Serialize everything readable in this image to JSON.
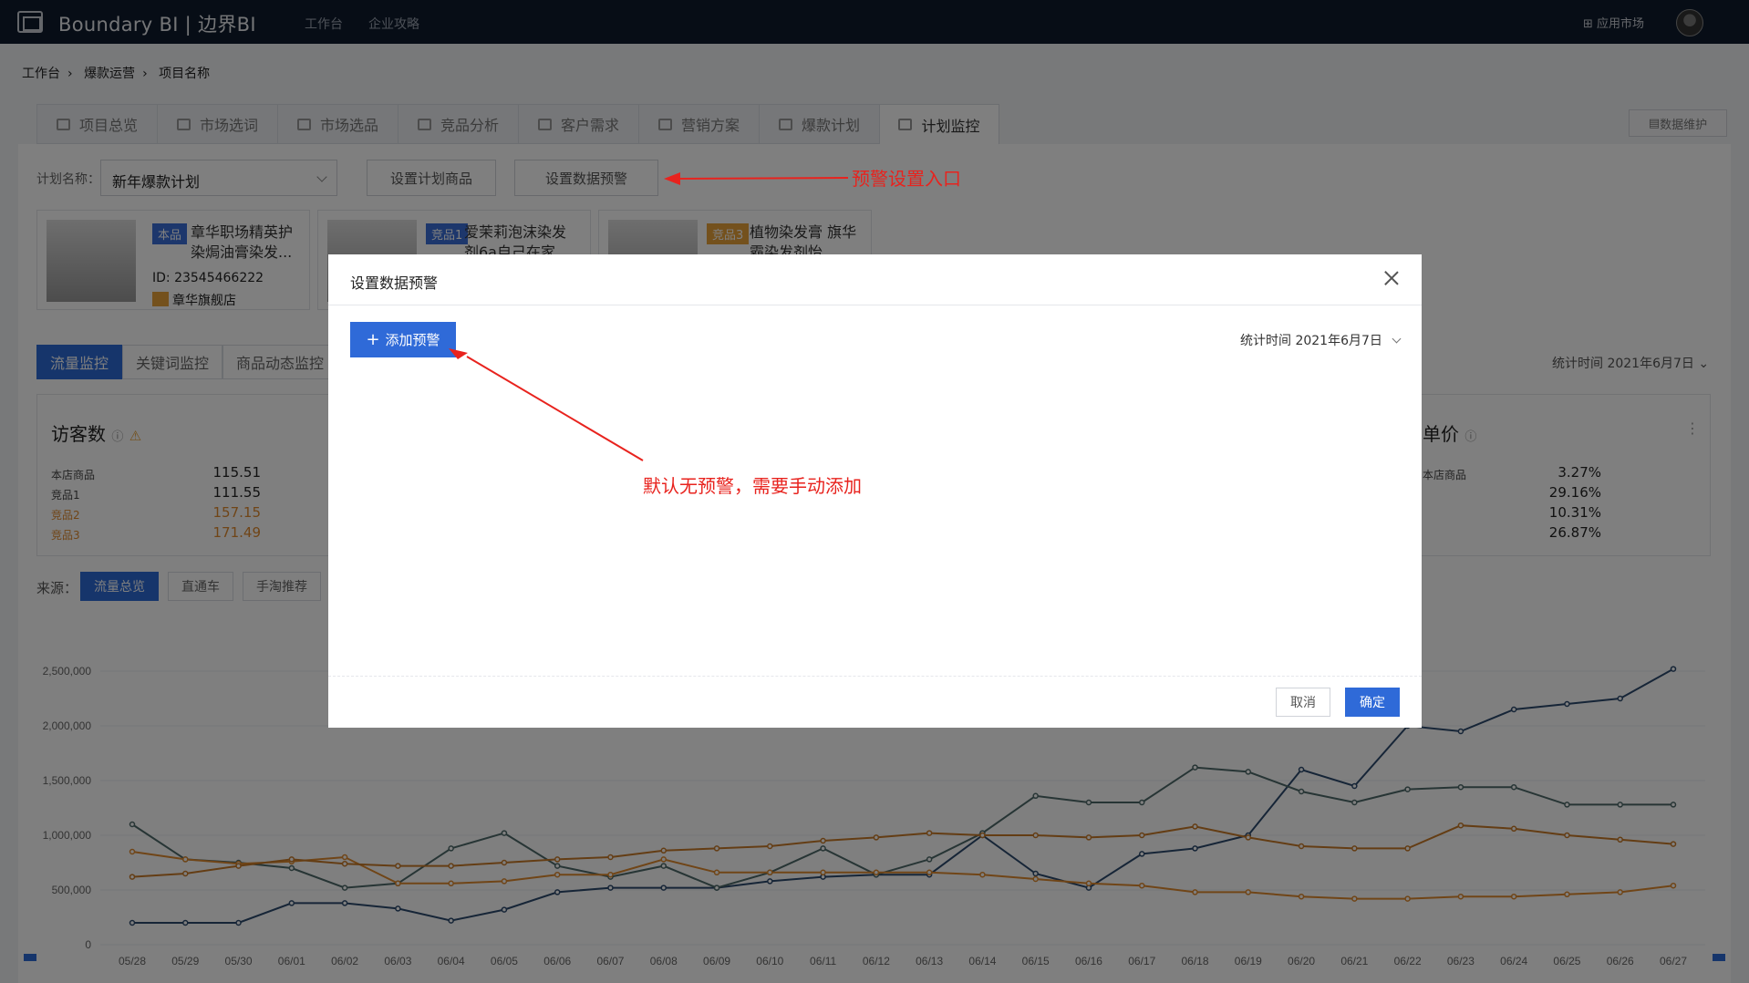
{
  "topbar": {
    "brand": "Boundary BI | 边界BI",
    "nav": [
      "工作台",
      "企业攻略"
    ],
    "app_market": "应用市场"
  },
  "breadcrumb": [
    "工作台",
    "爆款运营",
    "项目名称"
  ],
  "tabs": [
    "项目总览",
    "市场选词",
    "市场选品",
    "竞品分析",
    "客户需求",
    "营销方案",
    "爆款计划",
    "计划监控"
  ],
  "data_maint": "数据维护",
  "plan": {
    "label": "计划名称：",
    "value": "新年爆款计划",
    "btn_set_products": "设置计划商品",
    "btn_set_alert": "设置数据预警"
  },
  "annotations": {
    "alert_entry": "预警设置入口",
    "default_note": "默认无预警，需要手动添加"
  },
  "products": [
    {
      "badge": "本品",
      "badge_color": "#3a6fd8",
      "name": "章华职场精英护染焗油膏染发...",
      "id": "ID: 23545466222",
      "shop": "章华旗舰店"
    },
    {
      "badge": "竞品1",
      "badge_color": "#3a6fd8",
      "name": "爱茉莉泡沫染发剂6a自己在家..."
    },
    {
      "badge": "竞品3",
      "badge_color": "#e8a23a",
      "name": "植物染发膏 旗华霸染发剂怡..."
    }
  ],
  "subtabs": [
    "流量监控",
    "关键词监控",
    "商品动态监控"
  ],
  "stat_time": "统计时间 2021年6月7日",
  "metrics": {
    "title": "访客数",
    "rows": [
      {
        "label": "本店商品",
        "value": "115.51"
      },
      {
        "label": "竞品1",
        "value": "111.55"
      },
      {
        "label": "竞品2",
        "value": "157.15"
      },
      {
        "label": "竞品3",
        "value": "171.49"
      }
    ],
    "right_title": "单价",
    "right_rows": [
      {
        "label": "本店商品",
        "value": "3.27%"
      },
      {
        "label": "",
        "value": "29.16%"
      },
      {
        "label": "",
        "value": "10.31%"
      },
      {
        "label": "",
        "value": "26.87%"
      }
    ]
  },
  "source": {
    "label": "来源：",
    "buttons": [
      "流量总览",
      "直通车",
      "手淘推荐"
    ]
  },
  "chart_data": {
    "type": "line",
    "categories": [
      "05/28",
      "05/29",
      "05/30",
      "06/01",
      "06/02",
      "06/03",
      "06/04",
      "06/05",
      "06/06",
      "06/07",
      "06/08",
      "06/09",
      "06/10",
      "06/11",
      "06/12",
      "06/13",
      "06/14",
      "06/15",
      "06/16",
      "06/17",
      "06/18",
      "06/19",
      "06/20",
      "06/21",
      "06/22",
      "06/23",
      "06/24",
      "06/25",
      "06/26",
      "06/27"
    ],
    "ylim": [
      0,
      2500000
    ],
    "yticks": [
      "0",
      "500,000",
      "1,000,000",
      "1,500,000",
      "2,000,000",
      "2,500,000"
    ],
    "series": [
      {
        "color": "#2d4a6e",
        "values": [
          200000,
          200000,
          200000,
          380000,
          380000,
          330000,
          220000,
          320000,
          480000,
          520000,
          520000,
          520000,
          580000,
          620000,
          640000,
          640000,
          1000000,
          650000,
          520000,
          830000,
          880000,
          1000000,
          1600000,
          1450000,
          2000000,
          1950000,
          2150000,
          2200000,
          2250000,
          2520000
        ]
      },
      {
        "color": "#4e6a6a",
        "values": [
          1100000,
          780000,
          750000,
          700000,
          520000,
          560000,
          880000,
          1020000,
          720000,
          620000,
          720000,
          520000,
          660000,
          880000,
          640000,
          780000,
          1020000,
          1360000,
          1300000,
          1300000,
          1620000,
          1580000,
          1400000,
          1300000,
          1420000,
          1440000,
          1440000,
          1280000,
          1280000,
          1280000
        ]
      },
      {
        "color": "#e08a2e",
        "values": [
          850000,
          780000,
          740000,
          760000,
          800000,
          560000,
          560000,
          580000,
          640000,
          640000,
          780000,
          660000,
          660000,
          660000,
          660000,
          660000,
          640000,
          600000,
          560000,
          540000,
          480000,
          480000,
          440000,
          420000,
          420000,
          440000,
          440000,
          460000,
          480000,
          540000
        ]
      },
      {
        "color": "#c97a28",
        "values": [
          620000,
          650000,
          720000,
          780000,
          740000,
          720000,
          720000,
          750000,
          780000,
          800000,
          860000,
          880000,
          900000,
          950000,
          980000,
          1020000,
          1000000,
          1000000,
          980000,
          1000000,
          1080000,
          980000,
          900000,
          880000,
          880000,
          1090000,
          1060000,
          1000000,
          960000,
          920000
        ]
      }
    ]
  },
  "modal": {
    "title": "设置数据预警",
    "add_label": "添加预警",
    "stat_time": "统计时间 2021年6月7日",
    "cancel": "取消",
    "ok": "确定"
  }
}
